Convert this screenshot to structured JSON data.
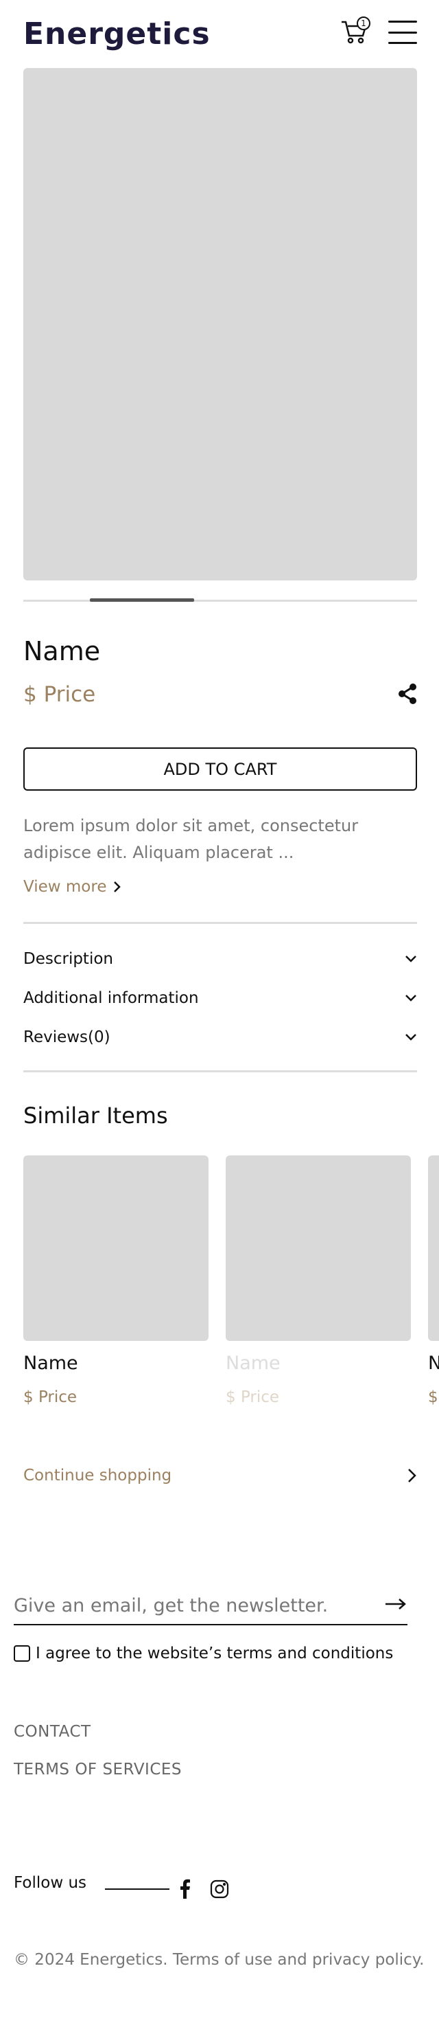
{
  "header": {
    "brand": "Energetics",
    "cart_count": "1"
  },
  "product": {
    "name": "Name",
    "price": "$ Price",
    "add_to_cart": "ADD TO CART",
    "description": "Lorem ipsum dolor sit amet, consectetur adipisce elit. Aliquam placerat ...",
    "view_more": "View more",
    "carousel_position": 0.2
  },
  "accordion": [
    {
      "label": "Description"
    },
    {
      "label": "Additional information"
    },
    {
      "label": "Reviews(0)"
    }
  ],
  "similar": {
    "title": "Similar Items",
    "items": [
      {
        "name": "Name",
        "price": "$ Price"
      },
      {
        "name": "Name",
        "price": "$ Price"
      },
      {
        "name": "Name",
        "price": "$ Price"
      }
    ],
    "continue_label": "Continue shopping"
  },
  "footer": {
    "newsletter_placeholder": "Give an email, get the newsletter.",
    "agree_label": "I agree to the website’s terms and conditions",
    "links": [
      "CONTACT",
      "TERMS OF SERVICES"
    ],
    "follow_label": "Follow us",
    "copyright": "© 2024 Energetics. Terms of use and privacy policy."
  },
  "colors": {
    "accent": "#9b8160",
    "brand": "#1e1a3c",
    "placeholder": "#d9d9d9"
  },
  "icons": [
    "cart-icon",
    "menu-icon",
    "share-icon",
    "chevron-right-icon",
    "chevron-down-icon",
    "arrow-right-icon",
    "facebook-icon",
    "instagram-icon"
  ]
}
